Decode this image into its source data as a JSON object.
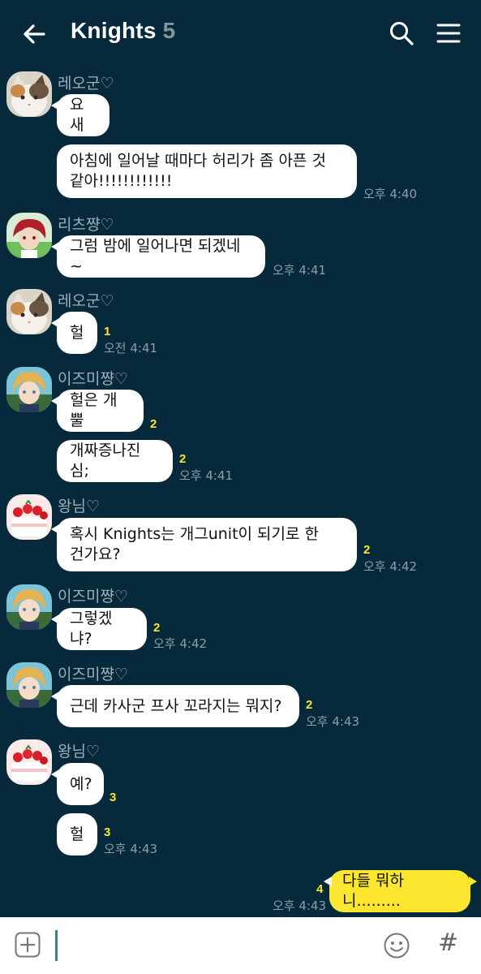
{
  "header": {
    "title": "Knights",
    "member_count": "5"
  },
  "messages": [
    {
      "sender": "레오군♡",
      "text": "요새"
    },
    {
      "text": "아침에 일어날 때마다 허리가 좀 아픈 것",
      "text2": "같아!!!!!!!!!!!!",
      "time": "오후 4:40"
    },
    {
      "sender": "리츠쨩♡",
      "text": "그럼 밤에 일어나면 되겠네~",
      "time": "오후 4:41"
    },
    {
      "sender": "레오군♡",
      "text": "헐",
      "unread": "1",
      "time": "오전 4:41"
    },
    {
      "sender": "이즈미쨩♡",
      "text": "헐은 개뿔",
      "unread": "2"
    },
    {
      "text": "개짜증나진심;",
      "unread": "2",
      "time": "오후 4:41"
    },
    {
      "sender": "왕님♡",
      "text": "혹시 Knights는 개그unit이 되기로 한",
      "text2": "건가요?",
      "unread": "2",
      "time": "오후 4:42"
    },
    {
      "sender": "이즈미쨩♡",
      "text": "그렇겠냐?",
      "unread": "2",
      "time": "오후 4:42"
    },
    {
      "sender": "이즈미쨩♡",
      "text": "근데 카사군 프사 꼬라지는 뭐지?",
      "unread": "2",
      "time": "오후 4:43"
    },
    {
      "sender": "왕님♡",
      "text": "예?",
      "unread": "3"
    },
    {
      "text": "헐",
      "unread": "3",
      "time": "오후 4:43"
    },
    {
      "mine": true,
      "text": "다들 뭐하니.........",
      "unread": "4",
      "time": "오후 4:43"
    }
  ],
  "input": {
    "placeholder": ""
  },
  "colors": {
    "background": "#062a3c",
    "bubble_other": "#ffffff",
    "bubble_mine": "#fde62f",
    "unread": "#fde62f"
  },
  "icons": [
    "back-arrow-icon",
    "search-icon",
    "menu-icon",
    "plus-icon",
    "emoji-icon",
    "hashtag-icon",
    "cat-avatar-icon",
    "red-hair-avatar-icon",
    "blonde-avatar-icon",
    "cake-avatar-icon"
  ]
}
